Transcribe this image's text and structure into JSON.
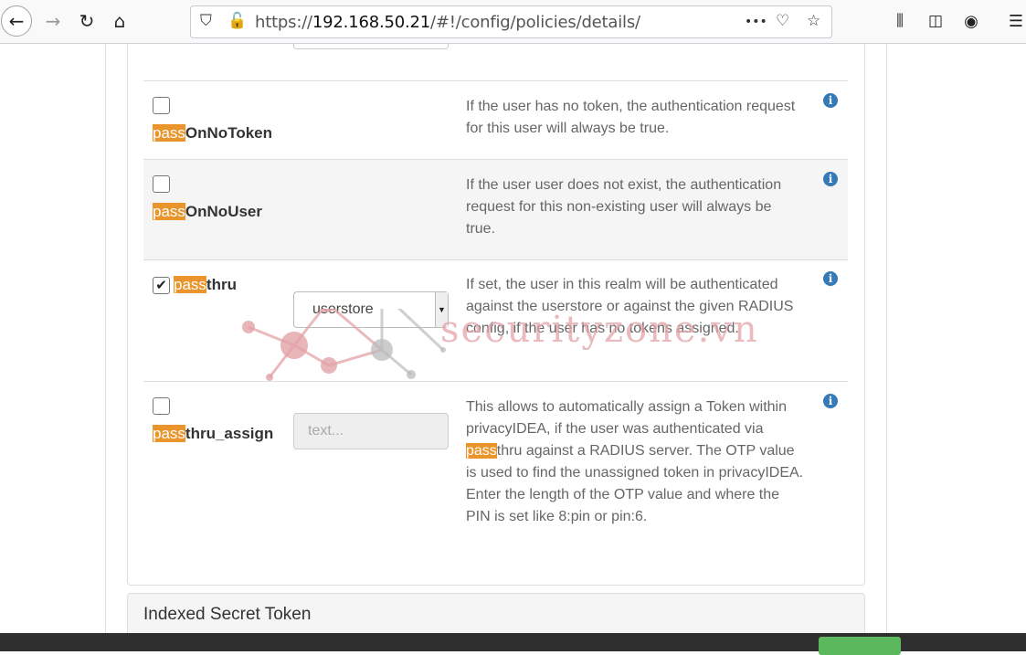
{
  "browser": {
    "url_prefix": "https://",
    "url_host": "192.168.50.21",
    "url_path": "/#!/config/policies/details/",
    "more_label": "•••"
  },
  "policies": [
    {
      "highlight": "pass",
      "name_rest": "OnNoToken",
      "checked": false,
      "description": "If the user has no token, the authentication request for this user will always be true."
    },
    {
      "highlight": "pass",
      "name_rest": "OnNoUser",
      "checked": false,
      "description": "If the user user does not exist, the authentication request for this non-existing user will always be true."
    },
    {
      "highlight": "pass",
      "name_rest": "thru",
      "checked": true,
      "select_value": "userstore",
      "description": "If set, the user in this realm will be authenticated against the userstore or against the given RADIUS config, if the user has no tokens assigned."
    },
    {
      "highlight": "pass",
      "name_rest": "thru_assign",
      "checked": false,
      "input_placeholder": "text...",
      "description_before": "This allows to automatically assign a Token within privacyIDEA, if the user was authenticated via ",
      "description_highlight": "pass",
      "description_after": "thru against a RADIUS server. The OTP value is used to find the unassigned token in privacyIDEA. Enter the length of the OTP value and where the PIN is set like 8:pin or pin:6."
    }
  ],
  "section_heading": "Indexed Secret Token",
  "watermark_text": "securityzone.vn",
  "colors": {
    "highlight": "#e9952b",
    "info_icon": "#337ab7",
    "watermark": "#e3a3a8"
  }
}
